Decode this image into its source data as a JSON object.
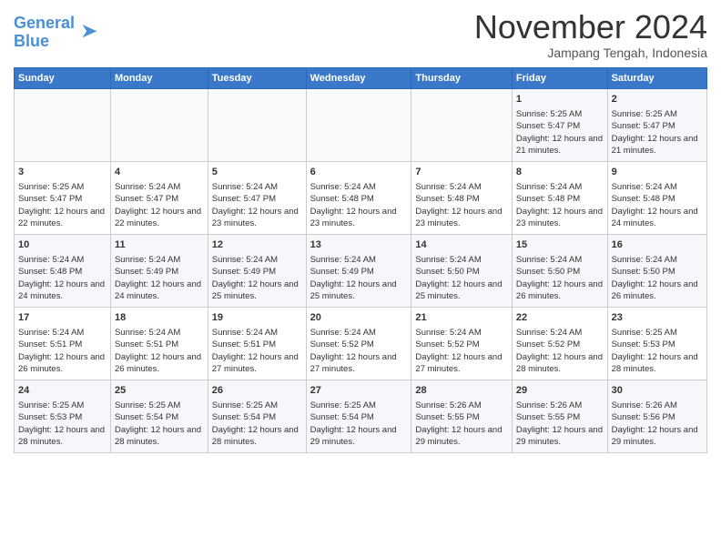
{
  "header": {
    "logo_line1": "General",
    "logo_line2": "Blue",
    "month": "November 2024",
    "location": "Jampang Tengah, Indonesia"
  },
  "weekdays": [
    "Sunday",
    "Monday",
    "Tuesday",
    "Wednesday",
    "Thursday",
    "Friday",
    "Saturday"
  ],
  "weeks": [
    [
      {
        "day": "",
        "info": ""
      },
      {
        "day": "",
        "info": ""
      },
      {
        "day": "",
        "info": ""
      },
      {
        "day": "",
        "info": ""
      },
      {
        "day": "",
        "info": ""
      },
      {
        "day": "1",
        "sunrise": "5:25 AM",
        "sunset": "5:47 PM",
        "daylight": "12 hours and 21 minutes."
      },
      {
        "day": "2",
        "sunrise": "5:25 AM",
        "sunset": "5:47 PM",
        "daylight": "12 hours and 21 minutes."
      }
    ],
    [
      {
        "day": "3",
        "sunrise": "5:25 AM",
        "sunset": "5:47 PM",
        "daylight": "12 hours and 22 minutes."
      },
      {
        "day": "4",
        "sunrise": "5:24 AM",
        "sunset": "5:47 PM",
        "daylight": "12 hours and 22 minutes."
      },
      {
        "day": "5",
        "sunrise": "5:24 AM",
        "sunset": "5:47 PM",
        "daylight": "12 hours and 23 minutes."
      },
      {
        "day": "6",
        "sunrise": "5:24 AM",
        "sunset": "5:48 PM",
        "daylight": "12 hours and 23 minutes."
      },
      {
        "day": "7",
        "sunrise": "5:24 AM",
        "sunset": "5:48 PM",
        "daylight": "12 hours and 23 minutes."
      },
      {
        "day": "8",
        "sunrise": "5:24 AM",
        "sunset": "5:48 PM",
        "daylight": "12 hours and 23 minutes."
      },
      {
        "day": "9",
        "sunrise": "5:24 AM",
        "sunset": "5:48 PM",
        "daylight": "12 hours and 24 minutes."
      }
    ],
    [
      {
        "day": "10",
        "sunrise": "5:24 AM",
        "sunset": "5:48 PM",
        "daylight": "12 hours and 24 minutes."
      },
      {
        "day": "11",
        "sunrise": "5:24 AM",
        "sunset": "5:49 PM",
        "daylight": "12 hours and 24 minutes."
      },
      {
        "day": "12",
        "sunrise": "5:24 AM",
        "sunset": "5:49 PM",
        "daylight": "12 hours and 25 minutes."
      },
      {
        "day": "13",
        "sunrise": "5:24 AM",
        "sunset": "5:49 PM",
        "daylight": "12 hours and 25 minutes."
      },
      {
        "day": "14",
        "sunrise": "5:24 AM",
        "sunset": "5:50 PM",
        "daylight": "12 hours and 25 minutes."
      },
      {
        "day": "15",
        "sunrise": "5:24 AM",
        "sunset": "5:50 PM",
        "daylight": "12 hours and 26 minutes."
      },
      {
        "day": "16",
        "sunrise": "5:24 AM",
        "sunset": "5:50 PM",
        "daylight": "12 hours and 26 minutes."
      }
    ],
    [
      {
        "day": "17",
        "sunrise": "5:24 AM",
        "sunset": "5:51 PM",
        "daylight": "12 hours and 26 minutes."
      },
      {
        "day": "18",
        "sunrise": "5:24 AM",
        "sunset": "5:51 PM",
        "daylight": "12 hours and 26 minutes."
      },
      {
        "day": "19",
        "sunrise": "5:24 AM",
        "sunset": "5:51 PM",
        "daylight": "12 hours and 27 minutes."
      },
      {
        "day": "20",
        "sunrise": "5:24 AM",
        "sunset": "5:52 PM",
        "daylight": "12 hours and 27 minutes."
      },
      {
        "day": "21",
        "sunrise": "5:24 AM",
        "sunset": "5:52 PM",
        "daylight": "12 hours and 27 minutes."
      },
      {
        "day": "22",
        "sunrise": "5:24 AM",
        "sunset": "5:52 PM",
        "daylight": "12 hours and 28 minutes."
      },
      {
        "day": "23",
        "sunrise": "5:25 AM",
        "sunset": "5:53 PM",
        "daylight": "12 hours and 28 minutes."
      }
    ],
    [
      {
        "day": "24",
        "sunrise": "5:25 AM",
        "sunset": "5:53 PM",
        "daylight": "12 hours and 28 minutes."
      },
      {
        "day": "25",
        "sunrise": "5:25 AM",
        "sunset": "5:54 PM",
        "daylight": "12 hours and 28 minutes."
      },
      {
        "day": "26",
        "sunrise": "5:25 AM",
        "sunset": "5:54 PM",
        "daylight": "12 hours and 28 minutes."
      },
      {
        "day": "27",
        "sunrise": "5:25 AM",
        "sunset": "5:54 PM",
        "daylight": "12 hours and 29 minutes."
      },
      {
        "day": "28",
        "sunrise": "5:26 AM",
        "sunset": "5:55 PM",
        "daylight": "12 hours and 29 minutes."
      },
      {
        "day": "29",
        "sunrise": "5:26 AM",
        "sunset": "5:55 PM",
        "daylight": "12 hours and 29 minutes."
      },
      {
        "day": "30",
        "sunrise": "5:26 AM",
        "sunset": "5:56 PM",
        "daylight": "12 hours and 29 minutes."
      }
    ]
  ],
  "labels": {
    "sunrise": "Sunrise:",
    "sunset": "Sunset:",
    "daylight": "Daylight hours"
  }
}
